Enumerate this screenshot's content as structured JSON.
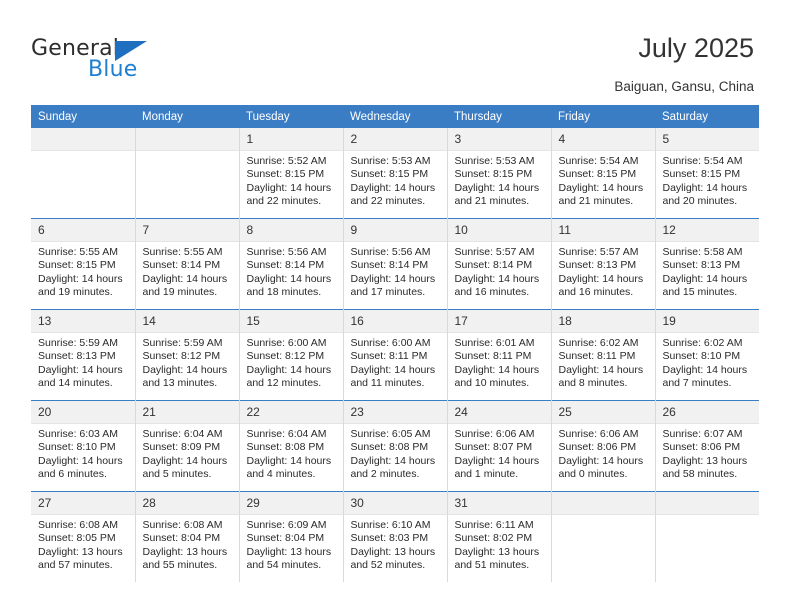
{
  "brand": {
    "name_top": "General",
    "name_bottom": "Blue",
    "accent_color": "#1f7fd0",
    "triangle_color": "#1f6fc0"
  },
  "header": {
    "title": "July 2025",
    "subtitle": "Baiguan, Gansu, China"
  },
  "calendar": {
    "header_bg": "#3b7dc4",
    "header_text_color": "#ffffff",
    "weekdays": [
      "Sunday",
      "Monday",
      "Tuesday",
      "Wednesday",
      "Thursday",
      "Friday",
      "Saturday"
    ],
    "labels": {
      "sunrise": "Sunrise:",
      "sunset": "Sunset:",
      "daylight": "Daylight:"
    },
    "weeks": [
      [
        {
          "day": "",
          "sunrise": "",
          "sunset": "",
          "daylight": ""
        },
        {
          "day": "",
          "sunrise": "",
          "sunset": "",
          "daylight": ""
        },
        {
          "day": "1",
          "sunrise": "Sunrise: 5:52 AM",
          "sunset": "Sunset: 8:15 PM",
          "daylight": "Daylight: 14 hours and 22 minutes."
        },
        {
          "day": "2",
          "sunrise": "Sunrise: 5:53 AM",
          "sunset": "Sunset: 8:15 PM",
          "daylight": "Daylight: 14 hours and 22 minutes."
        },
        {
          "day": "3",
          "sunrise": "Sunrise: 5:53 AM",
          "sunset": "Sunset: 8:15 PM",
          "daylight": "Daylight: 14 hours and 21 minutes."
        },
        {
          "day": "4",
          "sunrise": "Sunrise: 5:54 AM",
          "sunset": "Sunset: 8:15 PM",
          "daylight": "Daylight: 14 hours and 21 minutes."
        },
        {
          "day": "5",
          "sunrise": "Sunrise: 5:54 AM",
          "sunset": "Sunset: 8:15 PM",
          "daylight": "Daylight: 14 hours and 20 minutes."
        }
      ],
      [
        {
          "day": "6",
          "sunrise": "Sunrise: 5:55 AM",
          "sunset": "Sunset: 8:15 PM",
          "daylight": "Daylight: 14 hours and 19 minutes."
        },
        {
          "day": "7",
          "sunrise": "Sunrise: 5:55 AM",
          "sunset": "Sunset: 8:14 PM",
          "daylight": "Daylight: 14 hours and 19 minutes."
        },
        {
          "day": "8",
          "sunrise": "Sunrise: 5:56 AM",
          "sunset": "Sunset: 8:14 PM",
          "daylight": "Daylight: 14 hours and 18 minutes."
        },
        {
          "day": "9",
          "sunrise": "Sunrise: 5:56 AM",
          "sunset": "Sunset: 8:14 PM",
          "daylight": "Daylight: 14 hours and 17 minutes."
        },
        {
          "day": "10",
          "sunrise": "Sunrise: 5:57 AM",
          "sunset": "Sunset: 8:14 PM",
          "daylight": "Daylight: 14 hours and 16 minutes."
        },
        {
          "day": "11",
          "sunrise": "Sunrise: 5:57 AM",
          "sunset": "Sunset: 8:13 PM",
          "daylight": "Daylight: 14 hours and 16 minutes."
        },
        {
          "day": "12",
          "sunrise": "Sunrise: 5:58 AM",
          "sunset": "Sunset: 8:13 PM",
          "daylight": "Daylight: 14 hours and 15 minutes."
        }
      ],
      [
        {
          "day": "13",
          "sunrise": "Sunrise: 5:59 AM",
          "sunset": "Sunset: 8:13 PM",
          "daylight": "Daylight: 14 hours and 14 minutes."
        },
        {
          "day": "14",
          "sunrise": "Sunrise: 5:59 AM",
          "sunset": "Sunset: 8:12 PM",
          "daylight": "Daylight: 14 hours and 13 minutes."
        },
        {
          "day": "15",
          "sunrise": "Sunrise: 6:00 AM",
          "sunset": "Sunset: 8:12 PM",
          "daylight": "Daylight: 14 hours and 12 minutes."
        },
        {
          "day": "16",
          "sunrise": "Sunrise: 6:00 AM",
          "sunset": "Sunset: 8:11 PM",
          "daylight": "Daylight: 14 hours and 11 minutes."
        },
        {
          "day": "17",
          "sunrise": "Sunrise: 6:01 AM",
          "sunset": "Sunset: 8:11 PM",
          "daylight": "Daylight: 14 hours and 10 minutes."
        },
        {
          "day": "18",
          "sunrise": "Sunrise: 6:02 AM",
          "sunset": "Sunset: 8:11 PM",
          "daylight": "Daylight: 14 hours and 8 minutes."
        },
        {
          "day": "19",
          "sunrise": "Sunrise: 6:02 AM",
          "sunset": "Sunset: 8:10 PM",
          "daylight": "Daylight: 14 hours and 7 minutes."
        }
      ],
      [
        {
          "day": "20",
          "sunrise": "Sunrise: 6:03 AM",
          "sunset": "Sunset: 8:10 PM",
          "daylight": "Daylight: 14 hours and 6 minutes."
        },
        {
          "day": "21",
          "sunrise": "Sunrise: 6:04 AM",
          "sunset": "Sunset: 8:09 PM",
          "daylight": "Daylight: 14 hours and 5 minutes."
        },
        {
          "day": "22",
          "sunrise": "Sunrise: 6:04 AM",
          "sunset": "Sunset: 8:08 PM",
          "daylight": "Daylight: 14 hours and 4 minutes."
        },
        {
          "day": "23",
          "sunrise": "Sunrise: 6:05 AM",
          "sunset": "Sunset: 8:08 PM",
          "daylight": "Daylight: 14 hours and 2 minutes."
        },
        {
          "day": "24",
          "sunrise": "Sunrise: 6:06 AM",
          "sunset": "Sunset: 8:07 PM",
          "daylight": "Daylight: 14 hours and 1 minute."
        },
        {
          "day": "25",
          "sunrise": "Sunrise: 6:06 AM",
          "sunset": "Sunset: 8:06 PM",
          "daylight": "Daylight: 14 hours and 0 minutes."
        },
        {
          "day": "26",
          "sunrise": "Sunrise: 6:07 AM",
          "sunset": "Sunset: 8:06 PM",
          "daylight": "Daylight: 13 hours and 58 minutes."
        }
      ],
      [
        {
          "day": "27",
          "sunrise": "Sunrise: 6:08 AM",
          "sunset": "Sunset: 8:05 PM",
          "daylight": "Daylight: 13 hours and 57 minutes."
        },
        {
          "day": "28",
          "sunrise": "Sunrise: 6:08 AM",
          "sunset": "Sunset: 8:04 PM",
          "daylight": "Daylight: 13 hours and 55 minutes."
        },
        {
          "day": "29",
          "sunrise": "Sunrise: 6:09 AM",
          "sunset": "Sunset: 8:04 PM",
          "daylight": "Daylight: 13 hours and 54 minutes."
        },
        {
          "day": "30",
          "sunrise": "Sunrise: 6:10 AM",
          "sunset": "Sunset: 8:03 PM",
          "daylight": "Daylight: 13 hours and 52 minutes."
        },
        {
          "day": "31",
          "sunrise": "Sunrise: 6:11 AM",
          "sunset": "Sunset: 8:02 PM",
          "daylight": "Daylight: 13 hours and 51 minutes."
        },
        {
          "day": "",
          "sunrise": "",
          "sunset": "",
          "daylight": ""
        },
        {
          "day": "",
          "sunrise": "",
          "sunset": "",
          "daylight": ""
        }
      ]
    ]
  }
}
